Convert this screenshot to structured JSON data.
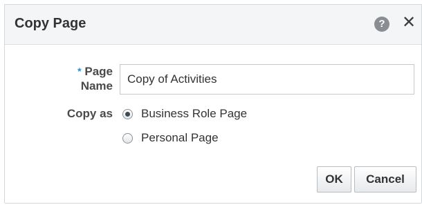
{
  "dialog": {
    "title": "Copy Page",
    "help_icon": "help-icon",
    "close_icon": "close-icon",
    "help_glyph": "?",
    "close_glyph": "✕"
  },
  "form": {
    "required_marker": "*",
    "page_name_label_line1": "Page",
    "page_name_label_line2": "Name",
    "page_name_value": "Copy of Activities",
    "copy_as_label": "Copy as",
    "options": [
      {
        "label": "Business Role Page",
        "checked": true
      },
      {
        "label": "Personal Page",
        "checked": false
      }
    ]
  },
  "buttons": {
    "ok": "OK",
    "cancel": "Cancel"
  }
}
